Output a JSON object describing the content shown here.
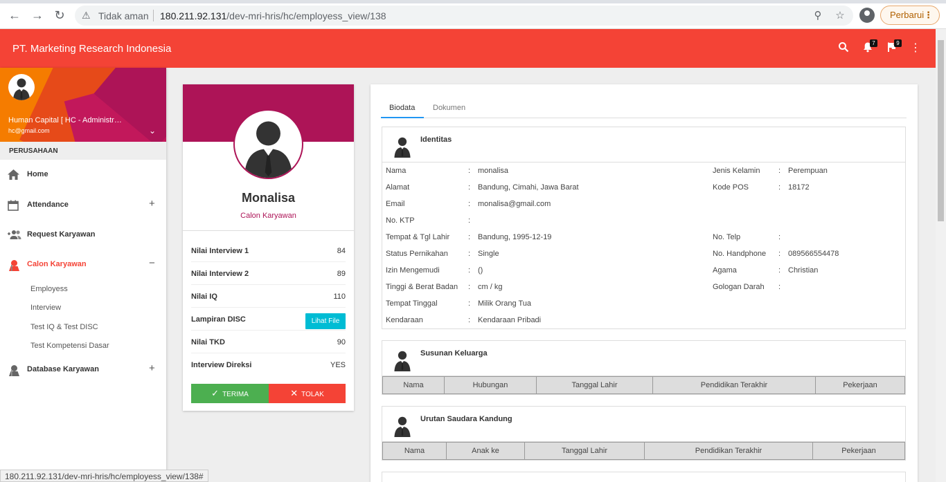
{
  "browser": {
    "security_label": "Tidak aman",
    "url_host": "180.211.92.131",
    "url_path": "/dev-mri-hris/hc/employess_view/138",
    "update_label": "Perbarui"
  },
  "header": {
    "title": "PT. Marketing Research Indonesia",
    "notifications_count": "7",
    "flags_count": "9"
  },
  "sidebar": {
    "user_name": "Human Capital [ HC - Administrator ]",
    "user_email": "hc@gmail.com",
    "section_header": "PERUSAHAAN",
    "items": [
      {
        "label": "Home"
      },
      {
        "label": "Attendance",
        "toggle": "+"
      },
      {
        "label": "Request Karyawan"
      },
      {
        "label": "Calon Karyawan",
        "toggle": "−"
      },
      {
        "label": "Database Karyawan",
        "toggle": "+"
      }
    ],
    "submenu": [
      "Employess",
      "Interview",
      "Test IQ & Test DISC",
      "Test Kompetensi Dasar"
    ]
  },
  "profile": {
    "name": "Monalisa",
    "role": "Calon Karyawan",
    "scores": [
      {
        "label": "Nilai Interview 1",
        "value": "84"
      },
      {
        "label": "Nilai Interview 2",
        "value": "89"
      },
      {
        "label": "Nilai IQ",
        "value": "110"
      },
      {
        "label": "Lampiran DISC",
        "button": "Lihat File"
      },
      {
        "label": "Nilai TKD",
        "value": "90"
      },
      {
        "label": "Interview Direksi",
        "value": "YES"
      }
    ],
    "accept_label": "TERIMA",
    "reject_label": "TOLAK"
  },
  "detail": {
    "tabs": [
      "Biodata",
      "Dokumen"
    ],
    "identitas": {
      "title": "Identitas",
      "left": [
        {
          "label": "Nama",
          "value": "monalisa"
        },
        {
          "label": "Alamat",
          "value": "Bandung, Cimahi, Jawa Barat"
        },
        {
          "label": "Email",
          "value": "monalisa@gmail.com"
        },
        {
          "label": "No. KTP",
          "value": ""
        },
        {
          "label": "Tempat & Tgl Lahir",
          "value": "Bandung, 1995-12-19"
        },
        {
          "label": "Status Pernikahan",
          "value": "Single"
        },
        {
          "label": "Izin Mengemudi",
          "value": "()"
        },
        {
          "label": "Tinggi & Berat Badan",
          "value": "cm / kg"
        },
        {
          "label": "Tempat Tinggal",
          "value": "Milik Orang Tua"
        },
        {
          "label": "Kendaraan",
          "value": "Kendaraan Pribadi"
        }
      ],
      "right": [
        {
          "label": "Jenis Kelamin",
          "value": "Perempuan"
        },
        {
          "label": "Kode POS",
          "value": "18172"
        },
        {
          "label": "No. Telp",
          "value": ""
        },
        {
          "label": "No. Handphone",
          "value": "089566554478"
        },
        {
          "label": "Agama",
          "value": "Christian"
        },
        {
          "label": "Gologan Darah",
          "value": ""
        }
      ]
    },
    "keluarga": {
      "title": "Susunan Keluarga",
      "columns": [
        "Nama",
        "Hubungan",
        "Tanggal Lahir",
        "Pendidikan Terakhir",
        "Pekerjaan"
      ]
    },
    "saudara": {
      "title": "Urutan Saudara Kandung",
      "columns": [
        "Nama",
        "Anak ke",
        "Tanggal Lahir",
        "Pendidikan Terakhir",
        "Pekerjaan"
      ]
    }
  },
  "status_url": "180.211.92.131/dev-mri-hris/hc/employess_view/138#",
  "colors": {
    "header": "#f44336",
    "profile_banner": "#ad1457",
    "accept": "#4caf50",
    "reject": "#f44336",
    "file_button": "#00bcd4",
    "tab_active": "#2196f3"
  },
  "icons": [
    "back-icon",
    "forward-icon",
    "reload-icon",
    "warning-icon",
    "zoom-icon",
    "star-icon",
    "profile-icon",
    "search-icon",
    "bell-icon",
    "flag-icon",
    "more-vert-icon",
    "home-icon",
    "calendar-icon",
    "people-add-icon",
    "person-pin-icon",
    "chevron-down-icon",
    "check-icon",
    "close-icon",
    "person-silhouette-icon"
  ]
}
